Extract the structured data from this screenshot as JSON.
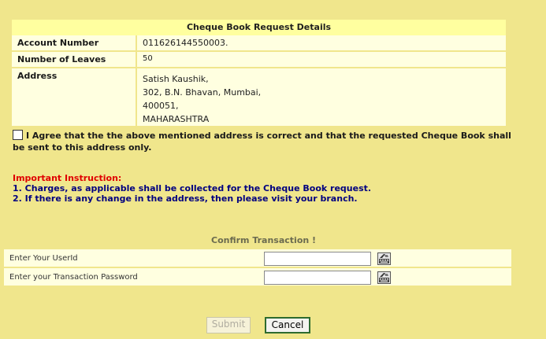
{
  "details": {
    "title": "Cheque Book Request Details",
    "account_label": "Account Number",
    "account_value": "011626144550003.",
    "leaves_label": "Number of Leaves",
    "leaves_value": "50",
    "address_label": "Address",
    "address_lines": [
      "Satish Kaushik,",
      "302, B.N. Bhavan, Mumbai,",
      "400051,",
      "MAHARASHTRA"
    ]
  },
  "agreement": {
    "text": "I Agree that the the above mentioned address is correct and that the requested Cheque Book shall be sent to this address only.",
    "checked": false
  },
  "instructions": {
    "heading": "Important Instruction:",
    "lines": [
      "1. Charges, as applicable shall be collected for the Cheque Book request.",
      "2. If there is any change in the address, then please visit your branch."
    ]
  },
  "confirm": {
    "title": "Confirm Transaction !",
    "userid_label": "Enter Your UserId",
    "userid_value": "",
    "password_label": "Enter your Transaction Password",
    "password_value": "",
    "icon": "virtual-keyboard-icon"
  },
  "buttons": {
    "submit_label": "Submit",
    "cancel_label": "Cancel"
  },
  "colors": {
    "page_bg": "#f0e68c",
    "row_bg": "#ffffe0",
    "header_bg": "#ffff9f",
    "instruction_heading": "#e00000",
    "instruction_text": "#000080"
  }
}
